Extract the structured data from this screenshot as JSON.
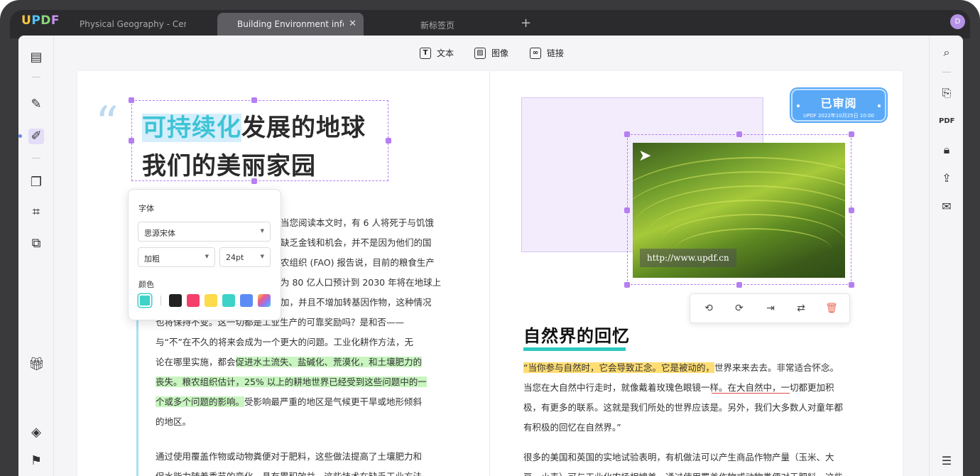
{
  "app": {
    "logo": "UPDF",
    "avatar_letter": "D"
  },
  "tabs": [
    {
      "label": "Physical Geography - Cent",
      "active": false
    },
    {
      "label": "Building Environment inforr",
      "active": true
    },
    {
      "label": "新标签页",
      "active": false
    }
  ],
  "toolbar": {
    "text_label": "文本",
    "image_label": "图像",
    "link_label": "链接"
  },
  "left_page": {
    "title_part1_highlight": "可持续化",
    "title_part1_rest": "发展的地球",
    "title_line2": "我们的美丽家园",
    "font_panel": {
      "font_label": "字体",
      "font_family_value": "思源宋体",
      "weight_value": "加粗",
      "size_value": "24pt",
      "color_label": "颜色",
      "selected_color": "#3ed3c8",
      "swatches": [
        "#222222",
        "#f43f6a",
        "#fddb4a",
        "#3ed3c8",
        "#5b8cf6",
        "gradient"
      ]
    },
    "para1": [
      "当您阅读本文时，有 6 人将死于与饥饿",
      "缺乏金钱和机会，并不是因为他们的国",
      "农组织 (FAO) 报告说，目前的粮食生产",
      "为 80 亿人口预计到 2030 年将在地球上",
      "加，并且不增加转基因作物，这种情况",
      "也将保持不变。这一切都是工业生产的可靠奖励吗？是和否——",
      "与“不”在不久的将来会成为一个更大的问题。工业化耕作方法，无"
    ],
    "para1_line8_prefix": "论在哪里实施，都会",
    "para1_line8_hl": "促进水土流失、盐碱化、荒漠化，和土壤肥力的",
    "para1_line9_hl": "丧失。粮农组织估计，25% 以上的耕地世界已经受到这些问题中的一",
    "para1_line10_hl": "个或多个问题的影响。",
    "para1_line10_rest": "受影响最严重的地区是气候更干旱或地形倾斜",
    "para1_line11": "的地区。",
    "para2": [
      "通过使用覆盖作物或动物粪便对于肥料，这些做法提高了土壤肥力和",
      "促水能力随着季节的变化，具有累积效益，这些技术在缺乏工业方法"
    ]
  },
  "right_page": {
    "stamp_title": "已审阅",
    "stamp_sub": "UPDF 2022年10月25日 10:00",
    "photo_url": "http://www.updf.cn",
    "section_title": "自然界的回忆",
    "line1_hl": "“当你参与自然时，它会导致正念。它是被动的，",
    "line1_rest": "世界来来去去。非常适合怀念。",
    "line2": "当您在大自然中行走时，就像戴着玫瑰色眼镜一样。在大自然中，一切都更加积",
    "line3": "极，有更多的联系。这就是我们所处的世界应该是。另外，我们大多数人对童年都",
    "line4": "有积极的回忆在自然界。”",
    "para2": [
      "很多的美国和英国的实地试验表明，有机做法可以产生商品作物产量（玉米、大",
      "豆、小麦）可与工业化农场相媲美。通过使用覆盖作物或动物粪便对于肥料，这些"
    ]
  },
  "colors": {
    "accent_purple": "#b57ef2",
    "highlight_cyan": "#3ec4d6",
    "section_underline": "#2ec9c1",
    "stamp_blue": "#5aa9f7"
  }
}
